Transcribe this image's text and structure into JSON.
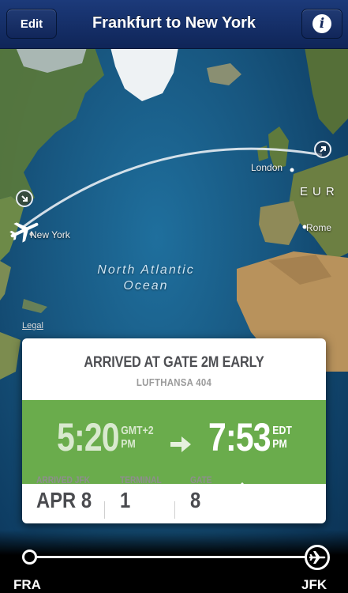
{
  "header": {
    "title": "Frankfurt to New York",
    "edit_label": "Edit",
    "info_glyph": "i"
  },
  "map": {
    "labels": {
      "london": "London",
      "europe": "EUR",
      "rome": "Rome",
      "new_york": "New York",
      "ocean_line1": "North Atlantic",
      "ocean_line2": "Ocean",
      "legal": "Legal"
    }
  },
  "card": {
    "status": "ARRIVED AT GATE 2M EARLY",
    "flight": "LUFTHANSA 404",
    "departure": {
      "time": "5:20",
      "tz_line1": "GMT+2",
      "tz_line2": "PM"
    },
    "arrival": {
      "time": "7:53",
      "tz_line1": "EDT",
      "tz_line2": "PM"
    },
    "details": [
      {
        "label": "ARRIVED JFK",
        "value": "APR 8"
      },
      {
        "label": "TERMINAL",
        "value": "1"
      },
      {
        "label": "GATE",
        "value": "8"
      }
    ]
  },
  "progress": {
    "from": "FRA",
    "to": "JFK",
    "fraction_complete": 1.0
  },
  "colors": {
    "header": "#13275b",
    "time_band": "#6aac4c",
    "status_text": "#4e4f53"
  }
}
